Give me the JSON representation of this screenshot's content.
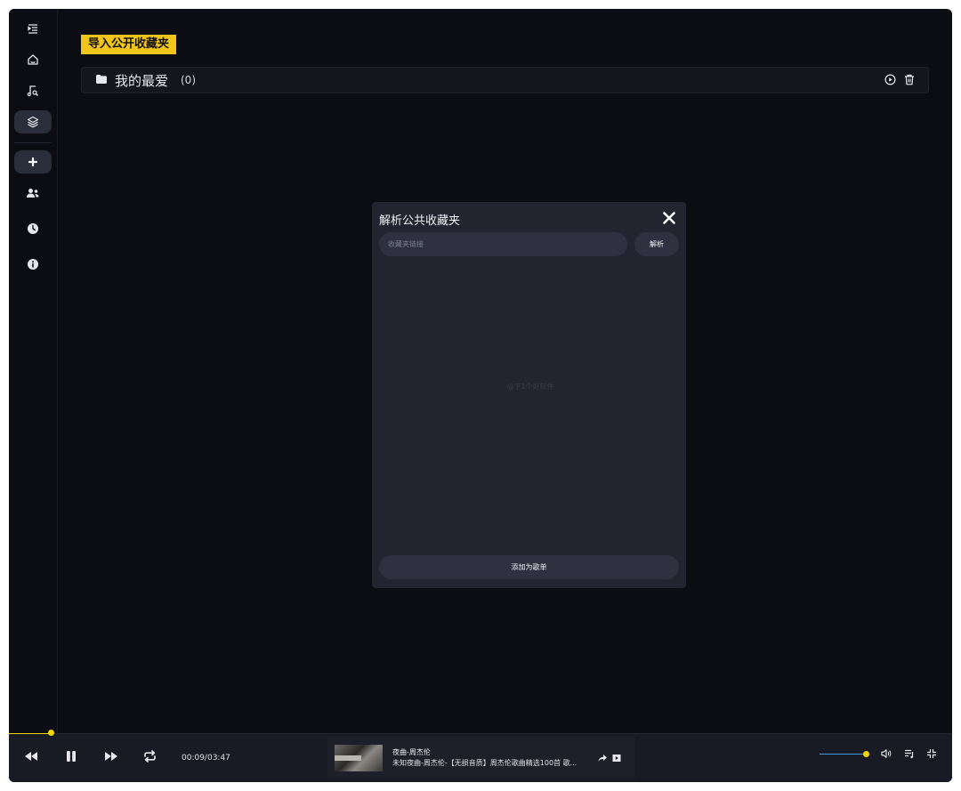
{
  "sidebar": {
    "items": [
      {
        "icon": "indent-list-icon"
      },
      {
        "icon": "home-icon"
      },
      {
        "icon": "music-search-icon"
      },
      {
        "icon": "layers-icon",
        "active": true
      },
      {
        "icon": "plus-icon"
      },
      {
        "icon": "users-icon"
      },
      {
        "icon": "clock-icon"
      },
      {
        "icon": "info-icon"
      }
    ]
  },
  "main": {
    "import_title": "导入公开收藏夹",
    "folder": {
      "name": "我的最爱",
      "count": "(0)"
    }
  },
  "modal": {
    "title": "解析公共收藏夹",
    "input_placeholder": "收藏夹链接",
    "input_value": "",
    "parse_label": "解析",
    "add_label": "添加为歌单",
    "empty_text": "@下1个好软件"
  },
  "player": {
    "progress": 0.044,
    "time": "00:09/03:47",
    "song_title": "夜曲-周杰伦",
    "song_subtitle": "未知夜曲-周杰伦-【无损音质】周杰伦歌曲精选100首 歌...",
    "volume": 1.0
  },
  "colors": {
    "accent": "#f2c51a",
    "background": "#0c0d12",
    "modal": "#23242f",
    "player": "#181a24"
  }
}
